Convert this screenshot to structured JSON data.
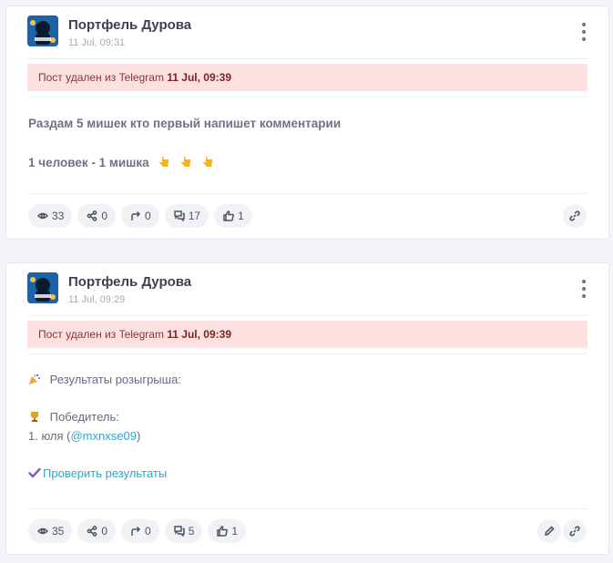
{
  "posts": [
    {
      "channel": "Портфель Дурова",
      "time": "11 Jul, 09:31",
      "deleted_prefix": "Пост удален из Telegram",
      "deleted_time": "11 Jul, 09:39",
      "lines": [
        "Раздам 5 мишек кто первый напишет комментарии",
        "1 человек - 1 мишка"
      ],
      "emoji_icons": [
        "point-down-icon",
        "point-down-icon",
        "point-down-icon"
      ],
      "stats": {
        "views": "33",
        "shares": "0",
        "forwards": "0",
        "comments": "17",
        "reactions": "1"
      }
    },
    {
      "channel": "Портфель Дурова",
      "time": "11 Jul, 09:29",
      "deleted_prefix": "Пост удален из Telegram",
      "deleted_time": "11 Jul, 09:39",
      "results_title": "Результаты розыгрыша:",
      "winner_label": "Победитель:",
      "winner_prefix": "1. юля (",
      "winner_handle": "@mxnxse09",
      "winner_suffix": ")",
      "check_link": "Проверить результаты",
      "stats": {
        "views": "35",
        "shares": "0",
        "forwards": "0",
        "comments": "5",
        "reactions": "1"
      }
    }
  ],
  "colors": {
    "accent": "#2ea6c9",
    "alert_bg": "#fde1e1",
    "alert_text": "#8a3535",
    "check": "#7b5ac4"
  }
}
